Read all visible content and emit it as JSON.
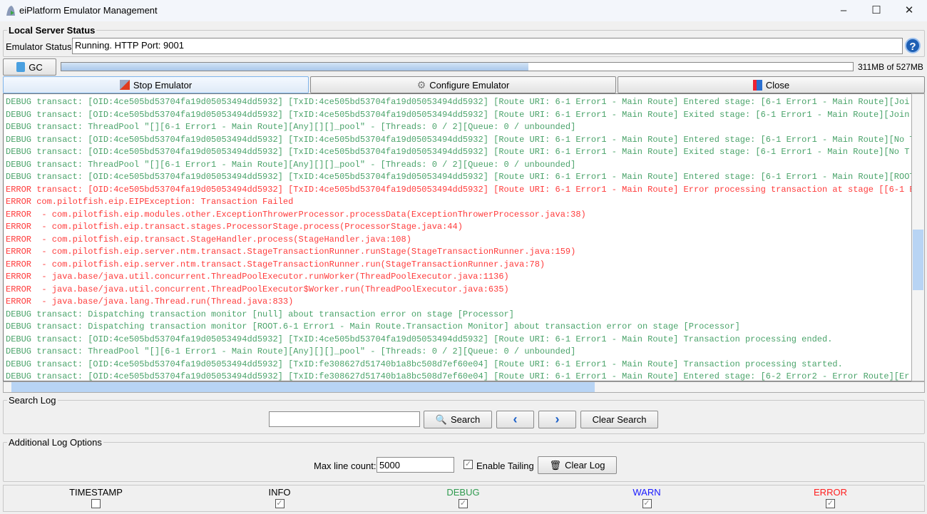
{
  "window": {
    "title": "eiPlatform Emulator Management"
  },
  "server": {
    "group_label": "Local Server Status",
    "status_label": "Emulator Status:",
    "status_value": "Running. HTTP Port: 9001"
  },
  "memory": {
    "gc_label": "GC",
    "used_fraction": 0.59,
    "text": "311MB of 527MB"
  },
  "actions": {
    "stop": "Stop Emulator",
    "configure": "Configure Emulator",
    "close": "Close"
  },
  "log_lines": [
    {
      "level": "DEBUG",
      "text": "DEBUG transact: [OID:4ce505bd53704fa19d05053494dd5932] [TxID:4ce505bd53704fa19d05053494dd5932] [Route URI: 6-1 Error1 - Main Route] Entered stage: [6-1 Error1 - Main Route][Joi"
    },
    {
      "level": "DEBUG",
      "text": "DEBUG transact: [OID:4ce505bd53704fa19d05053494dd5932] [TxID:4ce505bd53704fa19d05053494dd5932] [Route URI: 6-1 Error1 - Main Route] Exited stage: [6-1 Error1 - Main Route][Join"
    },
    {
      "level": "DEBUG",
      "text": "DEBUG transact: ThreadPool \"[][6-1 Error1 - Main Route][Any][][]_pool\" - [Threads: 0 / 2][Queue: 0 / unbounded]"
    },
    {
      "level": "DEBUG",
      "text": "DEBUG transact: [OID:4ce505bd53704fa19d05053494dd5932] [TxID:4ce505bd53704fa19d05053494dd5932] [Route URI: 6-1 Error1 - Main Route] Entered stage: [6-1 Error1 - Main Route][No T"
    },
    {
      "level": "DEBUG",
      "text": "DEBUG transact: [OID:4ce505bd53704fa19d05053494dd5932] [TxID:4ce505bd53704fa19d05053494dd5932] [Route URI: 6-1 Error1 - Main Route] Exited stage: [6-1 Error1 - Main Route][No T"
    },
    {
      "level": "DEBUG",
      "text": "DEBUG transact: ThreadPool \"[][6-1 Error1 - Main Route][Any][][]_pool\" - [Threads: 0 / 2][Queue: 0 / unbounded]"
    },
    {
      "level": "DEBUG",
      "text": "DEBUG transact: [OID:4ce505bd53704fa19d05053494dd5932] [TxID:4ce505bd53704fa19d05053494dd5932] [Route URI: 6-1 Error1 - Main Route] Entered stage: [6-1 Error1 - Main Route][ROOT"
    },
    {
      "level": "ERROR",
      "text": "ERROR transact: [OID:4ce505bd53704fa19d05053494dd5932] [TxID:4ce505bd53704fa19d05053494dd5932] [Route URI: 6-1 Error1 - Main Route] Error processing transaction at stage [[6-1 E"
    },
    {
      "level": "ERROR",
      "text": "ERROR com.pilotfish.eip.EIPException: Transaction Failed"
    },
    {
      "level": "ERROR",
      "text": "ERROR  - com.pilotfish.eip.modules.other.ExceptionThrowerProcessor.processData(ExceptionThrowerProcessor.java:38)"
    },
    {
      "level": "ERROR",
      "text": "ERROR  - com.pilotfish.eip.transact.stages.ProcessorStage.process(ProcessorStage.java:44)"
    },
    {
      "level": "ERROR",
      "text": "ERROR  - com.pilotfish.eip.transact.StageHandler.process(StageHandler.java:108)"
    },
    {
      "level": "ERROR",
      "text": "ERROR  - com.pilotfish.eip.server.ntm.transact.StageTransactionRunner.runStage(StageTransactionRunner.java:159)"
    },
    {
      "level": "ERROR",
      "text": "ERROR  - com.pilotfish.eip.server.ntm.transact.StageTransactionRunner.run(StageTransactionRunner.java:78)"
    },
    {
      "level": "ERROR",
      "text": "ERROR  - java.base/java.util.concurrent.ThreadPoolExecutor.runWorker(ThreadPoolExecutor.java:1136)"
    },
    {
      "level": "ERROR",
      "text": "ERROR  - java.base/java.util.concurrent.ThreadPoolExecutor$Worker.run(ThreadPoolExecutor.java:635)"
    },
    {
      "level": "ERROR",
      "text": "ERROR  - java.base/java.lang.Thread.run(Thread.java:833)"
    },
    {
      "level": "DEBUG",
      "text": "DEBUG transact: Dispatching transaction monitor [null] about transaction error on stage [Processor]"
    },
    {
      "level": "DEBUG",
      "text": "DEBUG transact: Dispatching transaction monitor [ROOT.6-1 Error1 - Main Route.Transaction Monitor] about transaction error on stage [Processor]"
    },
    {
      "level": "DEBUG",
      "text": "DEBUG transact: [OID:4ce505bd53704fa19d05053494dd5932] [TxID:4ce505bd53704fa19d05053494dd5932] [Route URI: 6-1 Error1 - Main Route] Transaction processing ended."
    },
    {
      "level": "DEBUG",
      "text": "DEBUG transact: ThreadPool \"[][6-1 Error1 - Main Route][Any][][]_pool\" - [Threads: 0 / 2][Queue: 0 / unbounded]"
    },
    {
      "level": "DEBUG",
      "text": "DEBUG transact: [OID:4ce505bd53704fa19d05053494dd5932] [TxID:fe308627d51740b1a8bc508d7ef60e04] [Route URI: 6-1 Error1 - Main Route] Transaction processing started."
    },
    {
      "level": "DEBUG",
      "text": "DEBUG transact: [OID:4ce505bd53704fa19d05053494dd5932] [TxID:fe308627d51740b1a8bc508d7ef60e04] [Route URI: 6-1 Error1 - Main Route] Entered stage: [6-2 Error2 - Error Route][Er"
    }
  ],
  "search": {
    "group_label": "Search Log",
    "value": "",
    "search_label": "Search",
    "clear_label": "Clear Search"
  },
  "options": {
    "group_label": "Additional Log Options",
    "max_line_label": "Max line count:",
    "max_line_value": "5000",
    "tailing_label": "Enable Tailing",
    "tailing_checked": true,
    "clear_log_label": "Clear Log"
  },
  "filters": [
    {
      "label": "TIMESTAMP",
      "checked": false,
      "color": "#000000"
    },
    {
      "label": "INFO",
      "checked": true,
      "color": "#000000"
    },
    {
      "label": "DEBUG",
      "checked": true,
      "color": "#2e9a4e"
    },
    {
      "label": "WARN",
      "checked": true,
      "color": "#1a1aff"
    },
    {
      "label": "ERROR",
      "checked": true,
      "color": "#ff2020"
    }
  ]
}
